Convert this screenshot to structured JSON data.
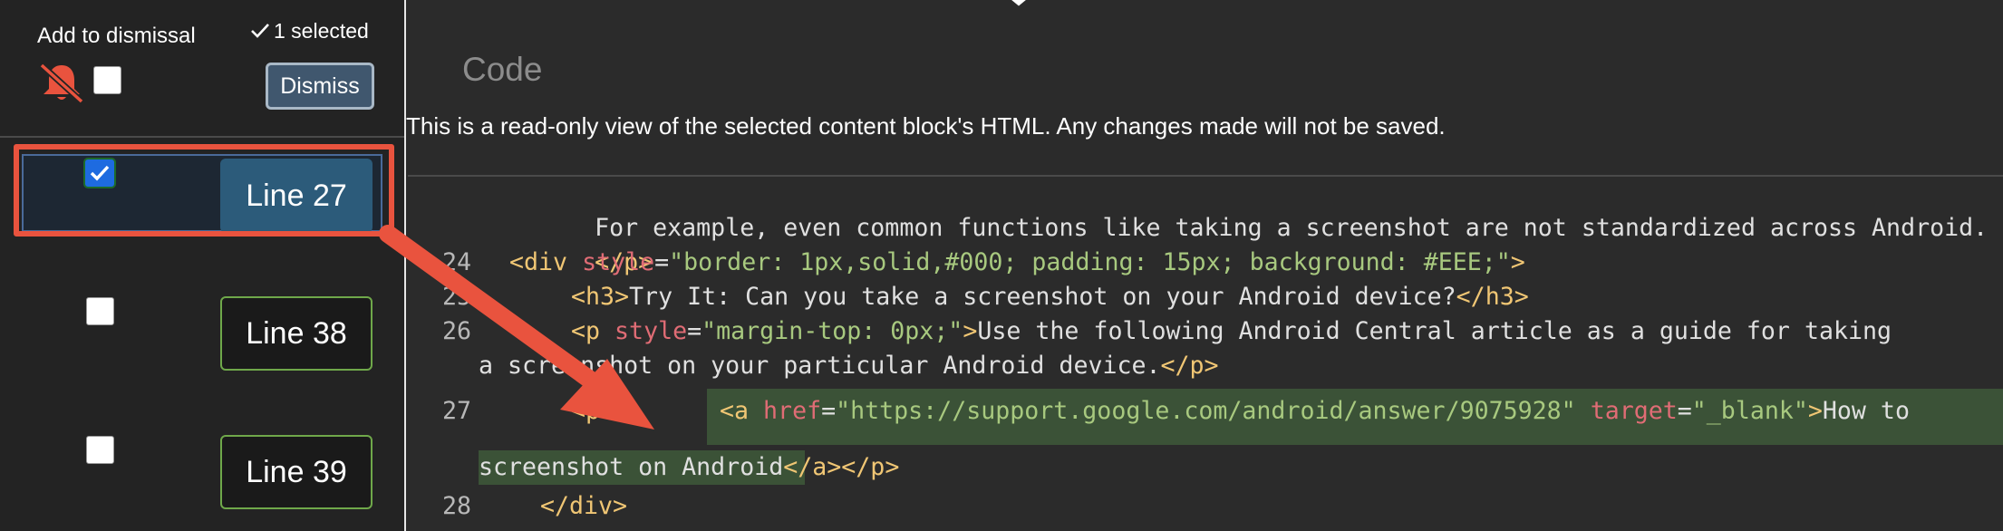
{
  "sidebar": {
    "add_dismissal_label": "Add to dismissal",
    "selected_count": "1 selected",
    "dismiss_label": "Dismiss",
    "items": [
      {
        "label": "Line 27",
        "checked": true
      },
      {
        "label": "Line 38",
        "checked": false
      },
      {
        "label": "Line 39",
        "checked": false
      }
    ]
  },
  "main": {
    "title": "Code",
    "notice": "This is a read-only view of the selected content block's HTML. Any changes made will not be saved."
  },
  "code": {
    "line_numbers": [
      "24",
      "25",
      "26",
      "27",
      "28"
    ],
    "l0": "For example, even common functions like taking a screenshot are not standardized across Android.",
    "l1_tag": "</p>",
    "l2_tag_open": "<div",
    "l2_attr": "style",
    "l2_eq": "=",
    "l2_val": "\"border: 1px,solid,#000; padding: 15px; background: #EEE;\"",
    "l2_tag_close": ">",
    "l3_tag_open": "<h3>",
    "l3_text": "Try It: Can you take a screenshot on your Android device?",
    "l3_tag_close": "</h3>",
    "l4_tag_open": "<p",
    "l4_attr": "style",
    "l4_eq": "=",
    "l4_val": "\"margin-top: 0px;\"",
    "l4_gt": ">",
    "l4_text": "Use the following Android Central article as a guide for taking",
    "l5_text": "a screenshot on your particular Android device.",
    "l5_tag": "</p>",
    "l6_p": "<p>",
    "l6_a_open": "<a",
    "l6_href": "href",
    "l6_eq1": "=",
    "l6_href_val": "\"https://support.google.com/android/answer/9075928\"",
    "l6_target": "target",
    "l6_eq2": "=",
    "l6_target_val": "\"_blank\"",
    "l6_gt": ">",
    "l6_text": "How to",
    "l7_text": "screenshot on Android",
    "l7_a_close": "</a>",
    "l7_p_close": "</p>",
    "l8_tag": "</div>"
  },
  "colors": {
    "highlight": "#e9533e",
    "selection": "#3b5237",
    "primary_button": "#2c5b7a",
    "outline_button": "#6fa84a"
  },
  "icons": [
    "bell-off-icon",
    "checkmark-icon",
    "close-icon",
    "arrow-annotation"
  ]
}
